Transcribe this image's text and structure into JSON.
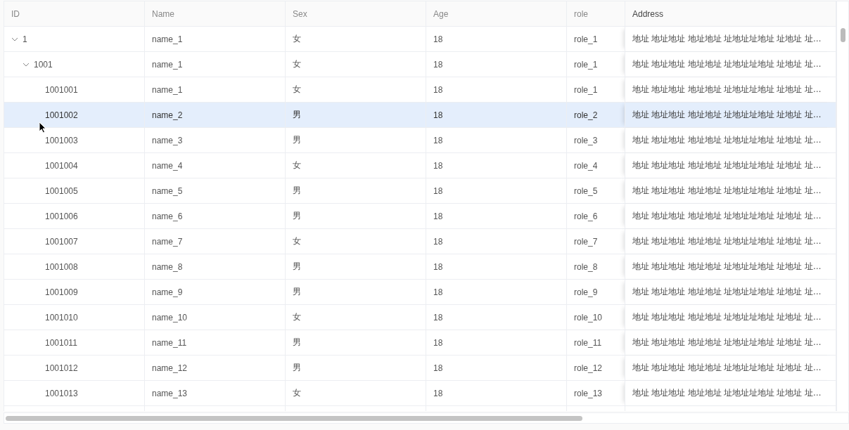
{
  "table": {
    "columns": [
      "ID",
      "Name",
      "Sex",
      "Age",
      "role",
      "Address"
    ],
    "rows": [
      {
        "id": "1",
        "name": "name_1",
        "sex": "女",
        "age": "18",
        "role": "role_1",
        "address": "地址 地址地址 地址地址 址地址址地址 址地址 址…",
        "selected": false,
        "expanded": true,
        "children": [
          {
            "id": "1001",
            "name": "name_1",
            "sex": "女",
            "age": "18",
            "role": "role_1",
            "address": "地址 地址地址 地址地址 址地址址地址 址地址 址…",
            "selected": false,
            "expanded": true,
            "children": [
              {
                "id": "1001001",
                "name": "name_1",
                "sex": "女",
                "age": "18",
                "role": "role_1",
                "address": "地址 地址地址 地址地址 址地址址地址 址地址 址…",
                "selected": false
              },
              {
                "id": "1001002",
                "name": "name_2",
                "sex": "男",
                "age": "18",
                "role": "role_2",
                "address": "地址 地址地址 地址地址 址地址址地址 址地址 址…",
                "selected": true
              },
              {
                "id": "1001003",
                "name": "name_3",
                "sex": "男",
                "age": "18",
                "role": "role_3",
                "address": "地址 地址地址 地址地址 址地址址地址 址地址 址…",
                "selected": false
              },
              {
                "id": "1001004",
                "name": "name_4",
                "sex": "女",
                "age": "18",
                "role": "role_4",
                "address": "地址 地址地址 地址地址 址地址址地址 址地址 址…",
                "selected": false
              },
              {
                "id": "1001005",
                "name": "name_5",
                "sex": "男",
                "age": "18",
                "role": "role_5",
                "address": "地址 地址地址 地址地址 址地址址地址 址地址 址…",
                "selected": false
              },
              {
                "id": "1001006",
                "name": "name_6",
                "sex": "男",
                "age": "18",
                "role": "role_6",
                "address": "地址 地址地址 地址地址 址地址址地址 址地址 址…",
                "selected": false
              },
              {
                "id": "1001007",
                "name": "name_7",
                "sex": "女",
                "age": "18",
                "role": "role_7",
                "address": "地址 地址地址 地址地址 址地址址地址 址地址 址…",
                "selected": false
              },
              {
                "id": "1001008",
                "name": "name_8",
                "sex": "男",
                "age": "18",
                "role": "role_8",
                "address": "地址 地址地址 地址地址 址地址址地址 址地址 址…",
                "selected": false
              },
              {
                "id": "1001009",
                "name": "name_9",
                "sex": "男",
                "age": "18",
                "role": "role_9",
                "address": "地址 地址地址 地址地址 址地址址地址 址地址 址…",
                "selected": false
              },
              {
                "id": "1001010",
                "name": "name_10",
                "sex": "女",
                "age": "18",
                "role": "role_10",
                "address": "地址 地址地址 地址地址 址地址址地址 址地址 址…",
                "selected": false
              },
              {
                "id": "1001011",
                "name": "name_11",
                "sex": "男",
                "age": "18",
                "role": "role_11",
                "address": "地址 地址地址 地址地址 址地址址地址 址地址 址…",
                "selected": false
              },
              {
                "id": "1001012",
                "name": "name_12",
                "sex": "男",
                "age": "18",
                "role": "role_12",
                "address": "地址 地址地址 地址地址 址地址址地址 址地址 址…",
                "selected": false
              },
              {
                "id": "1001013",
                "name": "name_13",
                "sex": "女",
                "age": "18",
                "role": "role_13",
                "address": "地址 地址地址 地址地址 址地址址地址 址地址 址…",
                "selected": false
              }
            ]
          }
        ]
      }
    ]
  }
}
